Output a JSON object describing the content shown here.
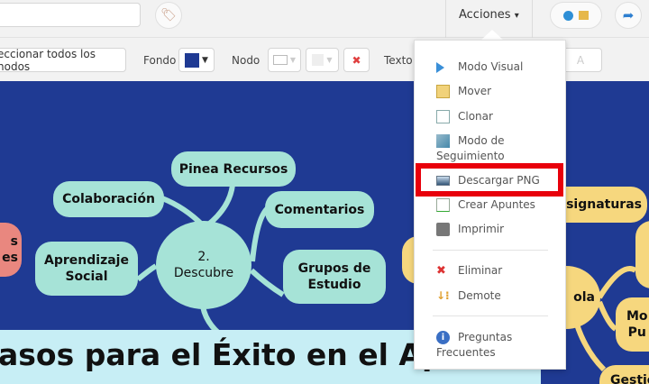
{
  "topbar": {
    "search_value": "",
    "actions_label": "Acciones",
    "actions_caret": "▾"
  },
  "toolbar": {
    "select_all_label": "eccionar todos los nodos",
    "background_label": "Fondo",
    "background_color": "#1f3a93",
    "node_label": "Nodo",
    "text_label": "Texto",
    "text_font_icon": "A"
  },
  "menu": {
    "items": [
      {
        "label": "Modo Visual",
        "icon": "play-icon"
      },
      {
        "label": "Mover",
        "icon": "move-icon"
      },
      {
        "label": "Clonar",
        "icon": "clone-icon"
      },
      {
        "label": "Modo de",
        "label2": "Seguimiento",
        "icon": "chart-icon"
      },
      {
        "label": "Descargar PNG",
        "icon": "image-icon"
      },
      {
        "label": "Crear Apuntes",
        "icon": "notes-icon"
      },
      {
        "label": "Imprimir",
        "icon": "printer-icon"
      },
      {
        "label": "Eliminar",
        "icon": "delete-icon"
      },
      {
        "label": "Demote",
        "icon": "demote-icon"
      },
      {
        "label": "Preguntas",
        "label2": "Frecuentes",
        "icon": "info-icon"
      }
    ],
    "highlight_color": "#e8000b"
  },
  "mindmap": {
    "center": "2.",
    "center2": "Descubre",
    "nodes": [
      "Pinea Recursos",
      "Colaboración",
      "Comentarios",
      "Aprendizaje",
      "Social",
      "Grupos de",
      "Estudio"
    ],
    "red_partial": [
      "s",
      "es"
    ],
    "yellow": [
      "signaturas",
      "ola",
      "Mo",
      "Pu",
      "Gestio"
    ],
    "banner": "asos para el Éxito en el Aprendizaje"
  }
}
